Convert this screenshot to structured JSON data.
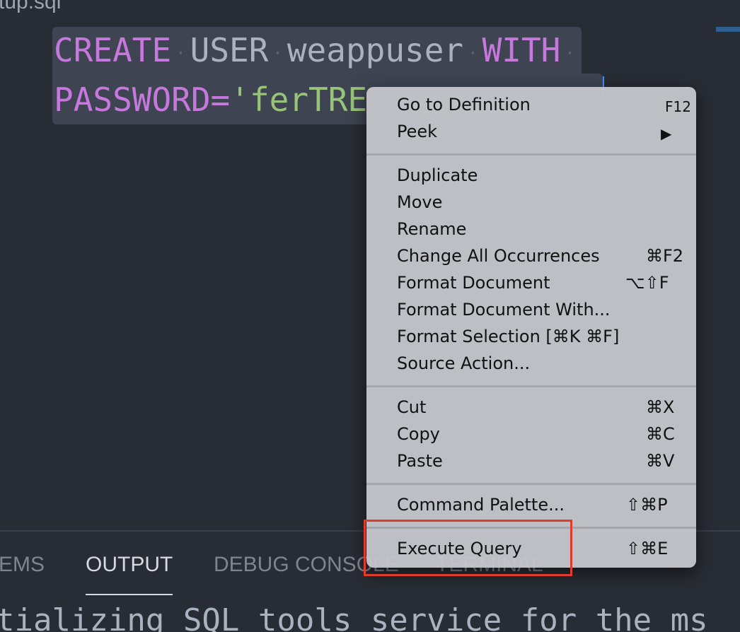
{
  "editor": {
    "tab_title": "tup.sql",
    "code": {
      "line1": {
        "kw1": "CREATE",
        "kw2": "USER",
        "ident": "weappuser",
        "kw3": "WITH"
      },
      "line2": {
        "kw": "PASSWORD=",
        "str": "'ferTRE"
      },
      "whitespace_glyph": "·"
    }
  },
  "context_menu": {
    "groups": [
      [
        {
          "label": "Go to Definition",
          "shortcut": "F12"
        },
        {
          "label": "Peek",
          "shortcut": "▶"
        }
      ],
      [
        {
          "label": "Duplicate",
          "shortcut": ""
        },
        {
          "label": "Move",
          "shortcut": ""
        },
        {
          "label": "Rename",
          "shortcut": ""
        },
        {
          "label": "Change All Occurrences",
          "shortcut": "⌘F2"
        },
        {
          "label": "Format Document",
          "shortcut": "⌥⇧F"
        },
        {
          "label": "Format Document With...",
          "shortcut": ""
        },
        {
          "label": "Format Selection [⌘K ⌘F]",
          "shortcut": ""
        },
        {
          "label": "Source Action...",
          "shortcut": ""
        }
      ],
      [
        {
          "label": "Cut",
          "shortcut": "⌘X"
        },
        {
          "label": "Copy",
          "shortcut": "⌘C"
        },
        {
          "label": "Paste",
          "shortcut": "⌘V"
        }
      ],
      [
        {
          "label": "Command Palette...",
          "shortcut": "⇧⌘P"
        }
      ],
      [
        {
          "label": "Execute Query",
          "shortcut": "⇧⌘E"
        }
      ]
    ]
  },
  "panel": {
    "tabs": [
      {
        "label": "EMS"
      },
      {
        "label": "OUTPUT"
      },
      {
        "label": "DEBUG CONSOLE"
      },
      {
        "label": "TERMINAL"
      }
    ],
    "output_text": "tializing SQL tools service for the ms"
  },
  "colors": {
    "highlight_box": "#e03c2b",
    "keyword": "#c678dd",
    "string": "#98c379"
  }
}
